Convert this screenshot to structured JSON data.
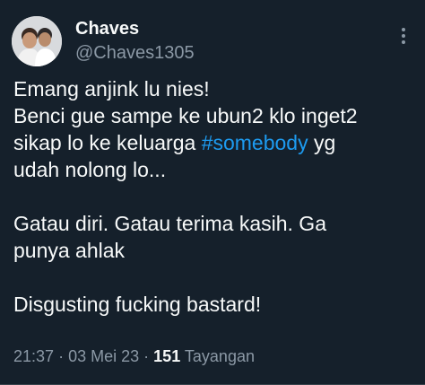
{
  "author": {
    "name": "Chaves",
    "handle": "@Chaves1305"
  },
  "tweet": {
    "line1": "Emang anjink lu nies!",
    "line2": "Benci gue sampe ke ubun2 klo inget2",
    "line3_before": "sikap lo ke keluarga ",
    "hashtag": "#somebody",
    "line3_after": " yg",
    "line4": "udah nolong lo...",
    "line5": "Gatau diri. Gatau terima kasih. Ga",
    "line6": "punya ahlak",
    "line7": "Disgusting fucking bastard!"
  },
  "meta": {
    "time": "21:37",
    "date": "03 Mei 23",
    "separator": "·",
    "views_count": "151",
    "views_label": "Tayangan"
  },
  "colors": {
    "background": "#15202b",
    "text": "#f7f9f9",
    "secondary": "#8b98a5",
    "accent": "#1d9bf0"
  },
  "icons": {
    "more": "more-options-icon"
  }
}
